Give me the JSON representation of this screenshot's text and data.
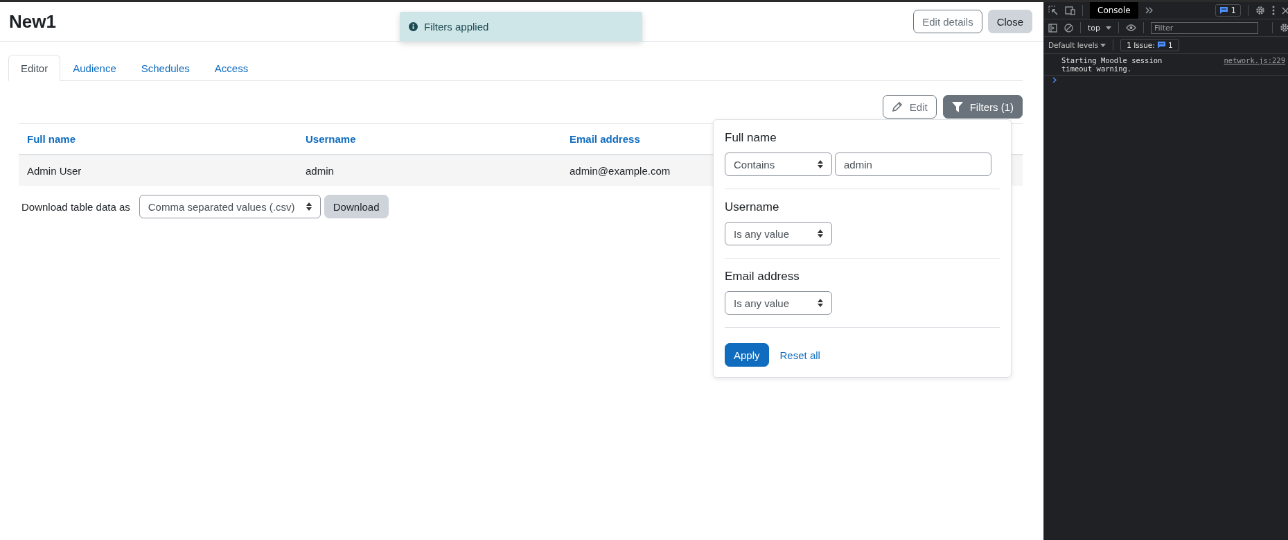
{
  "page": {
    "title": "New1",
    "header_buttons": [
      {
        "label": "Edit details",
        "kind": "outline"
      },
      {
        "label": "Close",
        "kind": "secondary"
      }
    ]
  },
  "toast": {
    "message": "Filters applied"
  },
  "tabs": [
    {
      "label": "Editor",
      "selected": true
    },
    {
      "label": "Audience",
      "selected": false
    },
    {
      "label": "Schedules",
      "selected": false
    },
    {
      "label": "Access",
      "selected": false
    }
  ],
  "toolbar": {
    "edit_button": "Edit",
    "filters_button": "Filters (1)"
  },
  "table": {
    "columns": [
      "Full name",
      "Username",
      "Email address"
    ],
    "rows": [
      [
        "Admin User",
        "admin",
        "admin@example.com"
      ]
    ]
  },
  "download": {
    "label": "Download table data as",
    "format": "Comma separated values (.csv)",
    "button": "Download"
  },
  "filters": {
    "sections": [
      {
        "label": "Full name",
        "operator": "Contains",
        "value": "admin"
      },
      {
        "label": "Username",
        "operator": "Is any value"
      },
      {
        "label": "Email address",
        "operator": "Is any value"
      }
    ],
    "apply": "Apply",
    "reset": "Reset all"
  },
  "devtools": {
    "tab": "Console",
    "issues_badge": "1",
    "context": "top",
    "filter_placeholder": "Filter",
    "levels": "Default levels",
    "issues_label": "1 Issue:",
    "issues_count": "1",
    "messages": [
      {
        "text": "Starting Moodle session timeout warning.",
        "source": "network.js:229"
      }
    ]
  }
}
